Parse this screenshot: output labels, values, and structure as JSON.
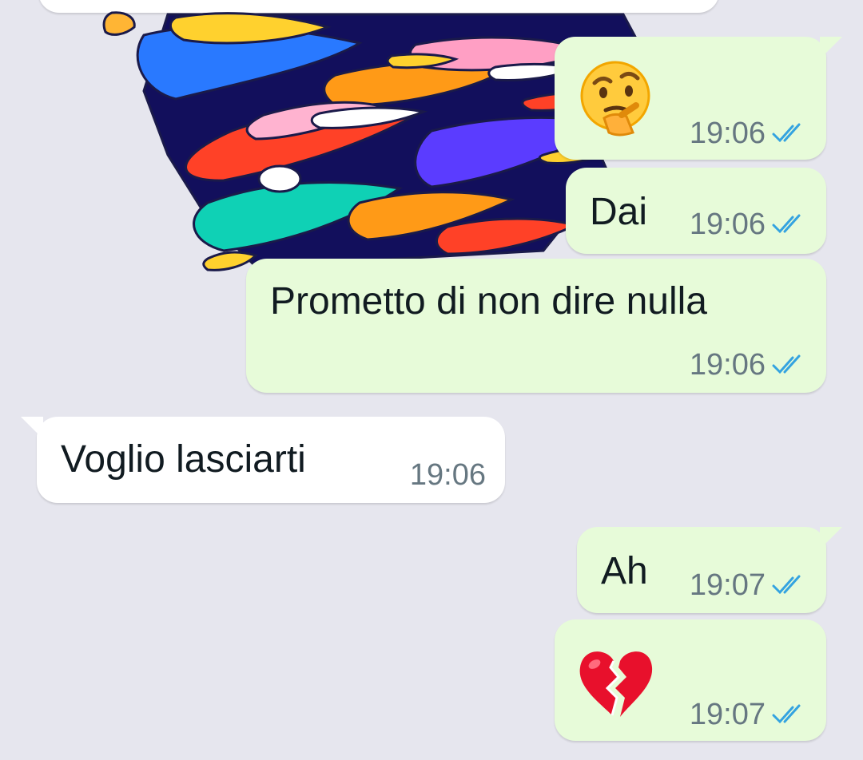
{
  "app": "WhatsApp",
  "colors": {
    "background": "#e6e6ee",
    "outgoing_bubble": "#e7fbd9",
    "incoming_bubble": "#ffffff",
    "text": "#111b21",
    "timestamp": "#667781",
    "read_ticks": "#34a3e0"
  },
  "messages": [
    {
      "direction": "out",
      "kind": "emoji",
      "emoji": "🤔",
      "icon": "thinking-face-icon",
      "time": "19:06",
      "status": "read"
    },
    {
      "direction": "out",
      "kind": "text",
      "text": "Dai",
      "time": "19:06",
      "status": "read"
    },
    {
      "direction": "out",
      "kind": "text",
      "text": "Prometto di non dire nulla",
      "time": "19:06",
      "status": "read"
    },
    {
      "direction": "in",
      "kind": "text",
      "text": "Voglio lasciarti",
      "time": "19:06"
    },
    {
      "direction": "out",
      "kind": "text",
      "text": "Ah",
      "time": "19:07",
      "status": "read"
    },
    {
      "direction": "out",
      "kind": "emoji",
      "emoji": "💔",
      "icon": "broken-heart-icon",
      "time": "19:07",
      "status": "read"
    }
  ],
  "media": {
    "icon": "abstract-sticker-image"
  }
}
